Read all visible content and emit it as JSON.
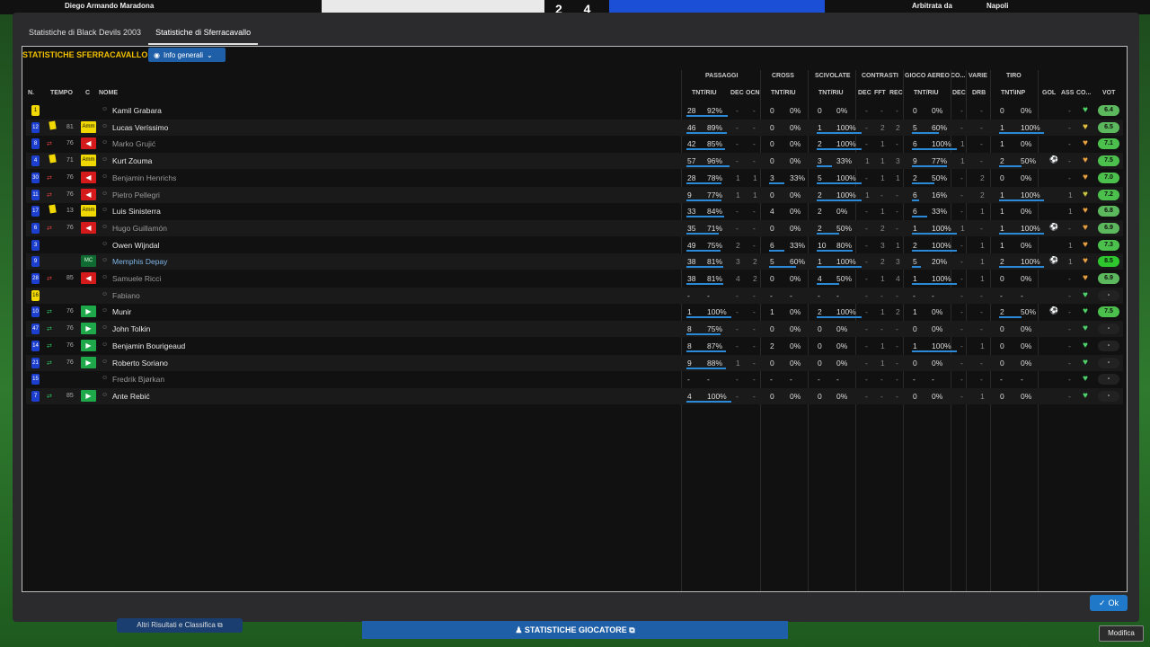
{
  "topbar": {
    "home_player": "Diego Armando Maradona",
    "score": "2 4",
    "referee_label": "Arbitrata da",
    "referee_city": "Napoli"
  },
  "tabs": [
    {
      "label": "Statistiche di Black Devils 2003",
      "active": false
    },
    {
      "label": "Statistiche di Sferracavallo",
      "active": true
    }
  ],
  "panel": {
    "title": "STATISTICHE SFERRACAVALLO",
    "view_dropdown": "Info generali"
  },
  "group_headers": {
    "passaggi": "PASSAGGI",
    "cross": "CROSS",
    "scivolate": "SCIVOLATE",
    "contrasti": "CONTRASTI",
    "gioco_aereo": "GIOCO AEREO",
    "co": "CO...",
    "varie": "VARIE",
    "tiro": "TIRO"
  },
  "columns": {
    "n": "N.",
    "tempo": "TEMPO",
    "c": "C",
    "nome": "NOME",
    "pass_tnt": "TNT/RIU",
    "pass_dec": "DEC",
    "pass_ocn": "OCN",
    "cross_tnt": "TNT/RIU",
    "sciv_tnt": "TNT/RIU",
    "contr_dec": "DEC",
    "contr_fft": "FFT",
    "contr_rec": "REC",
    "aereo_tnt": "TNT/RIU",
    "co_dec": "DEC",
    "varie_drb": "DRB",
    "tiro_tnt": "TNT\\INP",
    "gol": "GOL",
    "ass": "ASS",
    "cond": "CO...",
    "vot": "VOT"
  },
  "players": [
    {
      "num": "1",
      "gk": true,
      "card": false,
      "sub": "",
      "minute": "",
      "badge": "",
      "name": "Kamil Grabara",
      "name_style": "normal",
      "pass": [
        "28",
        "92%"
      ],
      "pass_pct": 92,
      "dec": "-",
      "ocn": "-",
      "cross": [
        "0",
        "0%"
      ],
      "cross_pct": 0,
      "sciv": [
        "0",
        "0%"
      ],
      "sciv_pct": 0,
      "cdec": "-",
      "cfft": "-",
      "crec": "-",
      "aereo": [
        "0",
        "0%"
      ],
      "aereo_pct": 0,
      "codec": "-",
      "drb": "-",
      "tiro": [
        "0",
        "0%"
      ],
      "tiro_pct": 0,
      "gol": "",
      "ass": "-",
      "heart": "#4ed36a",
      "vote": "6.4",
      "vote_color": "#5cb85c"
    },
    {
      "num": "12",
      "gk": false,
      "card": true,
      "sub": "",
      "minute": "81",
      "badge": "Amm",
      "name": "Lucas Veríssimo",
      "name_style": "normal",
      "pass": [
        "46",
        "89%"
      ],
      "pass_pct": 89,
      "dec": "-",
      "ocn": "-",
      "cross": [
        "0",
        "0%"
      ],
      "cross_pct": 0,
      "sciv": [
        "1",
        "100%"
      ],
      "sciv_pct": 100,
      "cdec": "-",
      "cfft": "2",
      "crec": "2",
      "aereo": [
        "5",
        "60%"
      ],
      "aereo_pct": 60,
      "codec": "-",
      "drb": "-",
      "tiro": [
        "1",
        "100%"
      ],
      "tiro_pct": 100,
      "gol": "",
      "ass": "-",
      "heart": "#e8c040",
      "vote": "6.5",
      "vote_color": "#5cb85c"
    },
    {
      "num": "8",
      "gk": false,
      "card": false,
      "sub": "out",
      "minute": "76",
      "badge": "out",
      "name": "Marko Grujić",
      "name_style": "sub",
      "pass": [
        "42",
        "85%"
      ],
      "pass_pct": 85,
      "dec": "-",
      "ocn": "-",
      "cross": [
        "0",
        "0%"
      ],
      "cross_pct": 0,
      "sciv": [
        "2",
        "100%"
      ],
      "sciv_pct": 100,
      "cdec": "-",
      "cfft": "1",
      "crec": "-",
      "aereo": [
        "6",
        "100%"
      ],
      "aereo_pct": 100,
      "codec": "1",
      "drb": "-",
      "tiro": [
        "1",
        "0%"
      ],
      "tiro_pct": 0,
      "gol": "",
      "ass": "-",
      "heart": "#e8a040",
      "vote": "7.1",
      "vote_color": "#4cc04c"
    },
    {
      "num": "4",
      "gk": false,
      "card": true,
      "sub": "",
      "minute": "71",
      "badge": "Amm",
      "name": "Kurt Zouma",
      "name_style": "normal",
      "pass": [
        "57",
        "96%"
      ],
      "pass_pct": 96,
      "dec": "-",
      "ocn": "-",
      "cross": [
        "0",
        "0%"
      ],
      "cross_pct": 0,
      "sciv": [
        "3",
        "33%"
      ],
      "sciv_pct": 33,
      "cdec": "1",
      "cfft": "1",
      "crec": "3",
      "aereo": [
        "9",
        "77%"
      ],
      "aereo_pct": 77,
      "codec": "1",
      "drb": "-",
      "tiro": [
        "2",
        "50%"
      ],
      "tiro_pct": 50,
      "gol": "ball",
      "ass": "-",
      "heart": "#e8a040",
      "vote": "7.5",
      "vote_color": "#4cc04c"
    },
    {
      "num": "30",
      "gk": false,
      "card": false,
      "sub": "out",
      "minute": "76",
      "badge": "out",
      "name": "Benjamin Henrichs",
      "name_style": "sub",
      "pass": [
        "28",
        "78%"
      ],
      "pass_pct": 78,
      "dec": "1",
      "ocn": "1",
      "cross": [
        "3",
        "33%"
      ],
      "cross_pct": 33,
      "sciv": [
        "5",
        "100%"
      ],
      "sciv_pct": 100,
      "cdec": "-",
      "cfft": "1",
      "crec": "1",
      "aereo": [
        "2",
        "50%"
      ],
      "aereo_pct": 50,
      "codec": "-",
      "drb": "2",
      "tiro": [
        "0",
        "0%"
      ],
      "tiro_pct": 0,
      "gol": "",
      "ass": "-",
      "heart": "#e8a040",
      "vote": "7.0",
      "vote_color": "#4cc04c"
    },
    {
      "num": "11",
      "gk": false,
      "card": false,
      "sub": "out",
      "minute": "76",
      "badge": "out",
      "name": "Pietro Pellegri",
      "name_style": "sub",
      "pass": [
        "9",
        "77%"
      ],
      "pass_pct": 77,
      "dec": "1",
      "ocn": "1",
      "cross": [
        "0",
        "0%"
      ],
      "cross_pct": 0,
      "sciv": [
        "2",
        "100%"
      ],
      "sciv_pct": 100,
      "cdec": "1",
      "cfft": "-",
      "crec": "-",
      "aereo": [
        "6",
        "16%"
      ],
      "aereo_pct": 16,
      "codec": "-",
      "drb": "2",
      "tiro": [
        "1",
        "100%"
      ],
      "tiro_pct": 100,
      "gol": "",
      "ass": "1",
      "heart": "#c8c840",
      "vote": "7.2",
      "vote_color": "#4cc04c"
    },
    {
      "num": "17",
      "gk": false,
      "card": true,
      "sub": "",
      "minute": "13",
      "badge": "Amm",
      "name": "Luis Sinisterra",
      "name_style": "normal",
      "pass": [
        "33",
        "84%"
      ],
      "pass_pct": 84,
      "dec": "-",
      "ocn": "-",
      "cross": [
        "4",
        "0%"
      ],
      "cross_pct": 0,
      "sciv": [
        "2",
        "0%"
      ],
      "sciv_pct": 0,
      "cdec": "-",
      "cfft": "1",
      "crec": "-",
      "aereo": [
        "6",
        "33%"
      ],
      "aereo_pct": 33,
      "codec": "-",
      "drb": "1",
      "tiro": [
        "1",
        "0%"
      ],
      "tiro_pct": 0,
      "gol": "",
      "ass": "1",
      "heart": "#e8a040",
      "vote": "6.8",
      "vote_color": "#5cb85c"
    },
    {
      "num": "6",
      "gk": false,
      "card": false,
      "sub": "out",
      "minute": "76",
      "badge": "out",
      "name": "Hugo Guillamón",
      "name_style": "sub",
      "pass": [
        "35",
        "71%"
      ],
      "pass_pct": 71,
      "dec": "-",
      "ocn": "-",
      "cross": [
        "0",
        "0%"
      ],
      "cross_pct": 0,
      "sciv": [
        "2",
        "50%"
      ],
      "sciv_pct": 50,
      "cdec": "-",
      "cfft": "2",
      "crec": "-",
      "aereo": [
        "1",
        "100%"
      ],
      "aereo_pct": 100,
      "codec": "1",
      "drb": "-",
      "tiro": [
        "1",
        "100%"
      ],
      "tiro_pct": 100,
      "gol": "ball",
      "ass": "-",
      "heart": "#e8a040",
      "vote": "6.9",
      "vote_color": "#5cb85c"
    },
    {
      "num": "3",
      "gk": false,
      "card": false,
      "sub": "",
      "minute": "",
      "badge": "",
      "name": "Owen Wijndal",
      "name_style": "normal",
      "pass": [
        "49",
        "75%"
      ],
      "pass_pct": 75,
      "dec": "2",
      "ocn": "-",
      "cross": [
        "6",
        "33%"
      ],
      "cross_pct": 33,
      "sciv": [
        "10",
        "80%"
      ],
      "sciv_pct": 80,
      "cdec": "-",
      "cfft": "3",
      "crec": "1",
      "aereo": [
        "2",
        "100%"
      ],
      "aereo_pct": 100,
      "codec": "-",
      "drb": "1",
      "tiro": [
        "1",
        "0%"
      ],
      "tiro_pct": 0,
      "gol": "",
      "ass": "1",
      "heart": "#e8a040",
      "vote": "7.3",
      "vote_color": "#4cc04c"
    },
    {
      "num": "9",
      "gk": false,
      "card": false,
      "sub": "",
      "minute": "",
      "badge": "MC",
      "name": "Memphis Depay",
      "name_style": "link",
      "pass": [
        "38",
        "81%"
      ],
      "pass_pct": 81,
      "dec": "3",
      "ocn": "2",
      "cross": [
        "5",
        "60%"
      ],
      "cross_pct": 60,
      "sciv": [
        "1",
        "100%"
      ],
      "sciv_pct": 100,
      "cdec": "-",
      "cfft": "2",
      "crec": "3",
      "aereo": [
        "5",
        "20%"
      ],
      "aereo_pct": 20,
      "codec": "-",
      "drb": "1",
      "tiro": [
        "2",
        "100%"
      ],
      "tiro_pct": 100,
      "gol": "ball",
      "ass": "1",
      "heart": "#e8a040",
      "vote": "8.5",
      "vote_color": "#2ec82e"
    },
    {
      "num": "28",
      "gk": false,
      "card": false,
      "sub": "out",
      "minute": "85",
      "badge": "out",
      "name": "Samuele Ricci",
      "name_style": "sub",
      "pass": [
        "38",
        "81%"
      ],
      "pass_pct": 81,
      "dec": "4",
      "ocn": "2",
      "cross": [
        "0",
        "0%"
      ],
      "cross_pct": 0,
      "sciv": [
        "4",
        "50%"
      ],
      "sciv_pct": 50,
      "cdec": "-",
      "cfft": "1",
      "crec": "4",
      "aereo": [
        "1",
        "100%"
      ],
      "aereo_pct": 100,
      "codec": "-",
      "drb": "1",
      "tiro": [
        "0",
        "0%"
      ],
      "tiro_pct": 0,
      "gol": "",
      "ass": "-",
      "heart": "#e8a040",
      "vote": "6.9",
      "vote_color": "#5cb85c"
    },
    {
      "num": "16",
      "gk": true,
      "card": false,
      "sub": "",
      "minute": "",
      "badge": "",
      "name": "Fabiano",
      "name_style": "sub",
      "pass": [
        "-",
        "-"
      ],
      "pass_pct": 0,
      "dec": "-",
      "ocn": "-",
      "cross": [
        "-",
        "-"
      ],
      "cross_pct": 0,
      "sciv": [
        "-",
        "-"
      ],
      "sciv_pct": 0,
      "cdec": "-",
      "cfft": "-",
      "crec": "-",
      "aereo": [
        "-",
        "-"
      ],
      "aereo_pct": 0,
      "codec": "-",
      "drb": "-",
      "tiro": [
        "-",
        "-"
      ],
      "tiro_pct": 0,
      "gol": "",
      "ass": "-",
      "heart": "#4ed36a",
      "vote": "-",
      "vote_color": "none"
    },
    {
      "num": "10",
      "gk": false,
      "card": false,
      "sub": "in",
      "minute": "76",
      "badge": "in",
      "name": "Munir",
      "name_style": "normal",
      "pass": [
        "1",
        "100%"
      ],
      "pass_pct": 100,
      "dec": "-",
      "ocn": "-",
      "cross": [
        "1",
        "0%"
      ],
      "cross_pct": 0,
      "sciv": [
        "2",
        "100%"
      ],
      "sciv_pct": 100,
      "cdec": "-",
      "cfft": "1",
      "crec": "2",
      "aereo": [
        "1",
        "0%"
      ],
      "aereo_pct": 0,
      "codec": "-",
      "drb": "-",
      "tiro": [
        "2",
        "50%"
      ],
      "tiro_pct": 50,
      "gol": "ball",
      "ass": "-",
      "heart": "#4ed36a",
      "vote": "7.5",
      "vote_color": "#4cc04c"
    },
    {
      "num": "47",
      "gk": false,
      "card": false,
      "sub": "in",
      "minute": "76",
      "badge": "in",
      "name": "John Tolkin",
      "name_style": "normal",
      "pass": [
        "8",
        "75%"
      ],
      "pass_pct": 75,
      "dec": "-",
      "ocn": "-",
      "cross": [
        "0",
        "0%"
      ],
      "cross_pct": 0,
      "sciv": [
        "0",
        "0%"
      ],
      "sciv_pct": 0,
      "cdec": "-",
      "cfft": "-",
      "crec": "-",
      "aereo": [
        "0",
        "0%"
      ],
      "aereo_pct": 0,
      "codec": "-",
      "drb": "-",
      "tiro": [
        "0",
        "0%"
      ],
      "tiro_pct": 0,
      "gol": "",
      "ass": "-",
      "heart": "#4ed36a",
      "vote": "-",
      "vote_color": "none"
    },
    {
      "num": "14",
      "gk": false,
      "card": false,
      "sub": "in",
      "minute": "76",
      "badge": "in",
      "name": "Benjamin Bourigeaud",
      "name_style": "normal",
      "pass": [
        "8",
        "87%"
      ],
      "pass_pct": 87,
      "dec": "-",
      "ocn": "-",
      "cross": [
        "2",
        "0%"
      ],
      "cross_pct": 0,
      "sciv": [
        "0",
        "0%"
      ],
      "sciv_pct": 0,
      "cdec": "-",
      "cfft": "1",
      "crec": "-",
      "aereo": [
        "1",
        "100%"
      ],
      "aereo_pct": 100,
      "codec": "-",
      "drb": "1",
      "tiro": [
        "0",
        "0%"
      ],
      "tiro_pct": 0,
      "gol": "",
      "ass": "-",
      "heart": "#4ed36a",
      "vote": "-",
      "vote_color": "none"
    },
    {
      "num": "21",
      "gk": false,
      "card": false,
      "sub": "in",
      "minute": "76",
      "badge": "in",
      "name": "Roberto Soriano",
      "name_style": "normal",
      "pass": [
        "9",
        "88%"
      ],
      "pass_pct": 88,
      "dec": "1",
      "ocn": "-",
      "cross": [
        "0",
        "0%"
      ],
      "cross_pct": 0,
      "sciv": [
        "0",
        "0%"
      ],
      "sciv_pct": 0,
      "cdec": "-",
      "cfft": "1",
      "crec": "-",
      "aereo": [
        "0",
        "0%"
      ],
      "aereo_pct": 0,
      "codec": "-",
      "drb": "-",
      "tiro": [
        "0",
        "0%"
      ],
      "tiro_pct": 0,
      "gol": "",
      "ass": "-",
      "heart": "#4ed36a",
      "vote": "-",
      "vote_color": "none"
    },
    {
      "num": "15",
      "gk": false,
      "card": false,
      "sub": "",
      "minute": "",
      "badge": "",
      "name": "Fredrik Bjørkan",
      "name_style": "sub",
      "pass": [
        "-",
        "-"
      ],
      "pass_pct": 0,
      "dec": "-",
      "ocn": "-",
      "cross": [
        "-",
        "-"
      ],
      "cross_pct": 0,
      "sciv": [
        "-",
        "-"
      ],
      "sciv_pct": 0,
      "cdec": "-",
      "cfft": "-",
      "crec": "-",
      "aereo": [
        "-",
        "-"
      ],
      "aereo_pct": 0,
      "codec": "-",
      "drb": "-",
      "tiro": [
        "-",
        "-"
      ],
      "tiro_pct": 0,
      "gol": "",
      "ass": "-",
      "heart": "#4ed36a",
      "vote": "-",
      "vote_color": "none"
    },
    {
      "num": "7",
      "gk": false,
      "card": false,
      "sub": "in",
      "minute": "85",
      "badge": "in",
      "name": "Ante Rebić",
      "name_style": "normal",
      "pass": [
        "4",
        "100%"
      ],
      "pass_pct": 100,
      "dec": "-",
      "ocn": "-",
      "cross": [
        "0",
        "0%"
      ],
      "cross_pct": 0,
      "sciv": [
        "0",
        "0%"
      ],
      "sciv_pct": 0,
      "cdec": "-",
      "cfft": "-",
      "crec": "-",
      "aereo": [
        "0",
        "0%"
      ],
      "aereo_pct": 0,
      "codec": "-",
      "drb": "1",
      "tiro": [
        "0",
        "0%"
      ],
      "tiro_pct": 0,
      "gol": "",
      "ass": "-",
      "heart": "#4ed36a",
      "vote": "-",
      "vote_color": "none"
    }
  ],
  "buttons": {
    "ok": "Ok",
    "altri_risultati": "Altri Risultati e Classifica",
    "statistiche_giocatore": "STATISTICHE GIOCATORE",
    "modifica": "Modifica"
  },
  "colors": {
    "title_yellow": "#f0c000",
    "accent_blue": "#1f78c8",
    "panel_bg": "#111111"
  }
}
